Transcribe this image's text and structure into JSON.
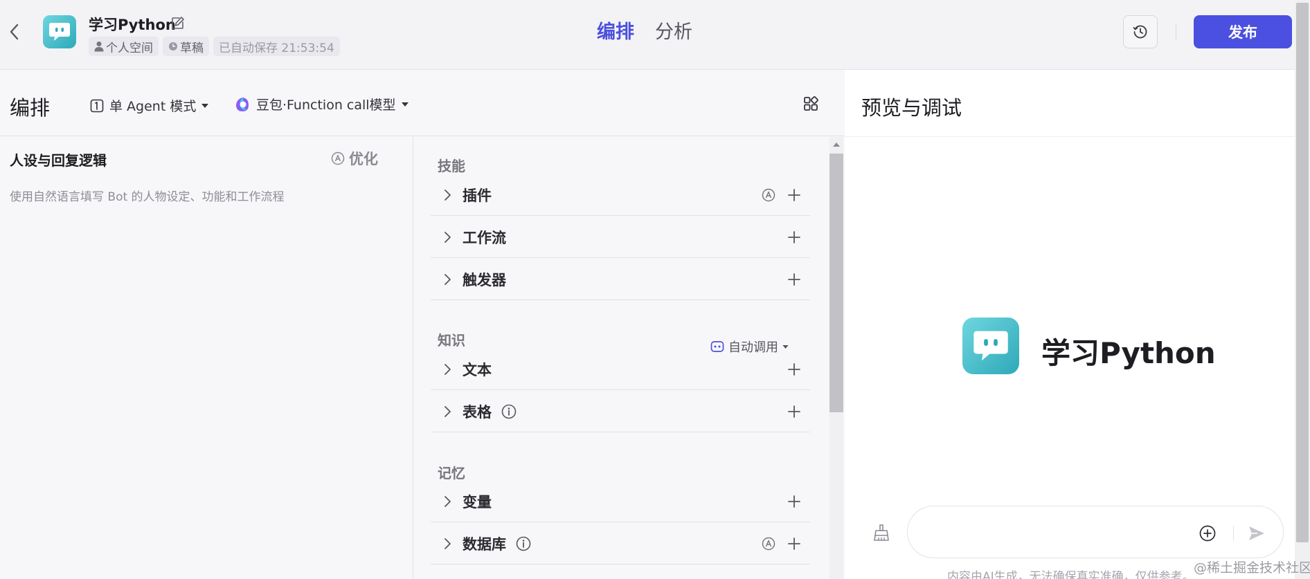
{
  "header": {
    "bot_name": "学习Python",
    "space": "个人空间",
    "status": "草稿",
    "autosave": "已自动保存 21:53:54",
    "tabs": [
      {
        "label": "编排",
        "active": true
      },
      {
        "label": "分析",
        "active": false
      }
    ],
    "publish_label": "发布"
  },
  "toolbar": {
    "title": "编排",
    "mode": "单 Agent 模式",
    "model": "豆包·Function call模型"
  },
  "persona": {
    "title": "人设与回复逻辑",
    "optimize_label": "优化",
    "placeholder": "使用自然语言填写 Bot 的人物设定、功能和工作流程"
  },
  "skills": {
    "sections": [
      {
        "title": "技能",
        "items": [
          "插件",
          "工作流",
          "触发器"
        ]
      },
      {
        "title": "知识",
        "action": "自动调用",
        "items": [
          "文本",
          "表格"
        ]
      },
      {
        "title": "记忆",
        "items": [
          "变量",
          "数据库"
        ]
      }
    ]
  },
  "preview": {
    "title": "预览与调试",
    "bot_name": "学习Python",
    "input_placeholder": "",
    "disclaimer": "内容由AI生成，无法确保真实准确，仅供参考。"
  },
  "watermark": "@稀土掘金技术社区",
  "colors": {
    "accent": "#4b50e0",
    "logo_start": "#6fd6df",
    "logo_end": "#2ea9b8"
  }
}
